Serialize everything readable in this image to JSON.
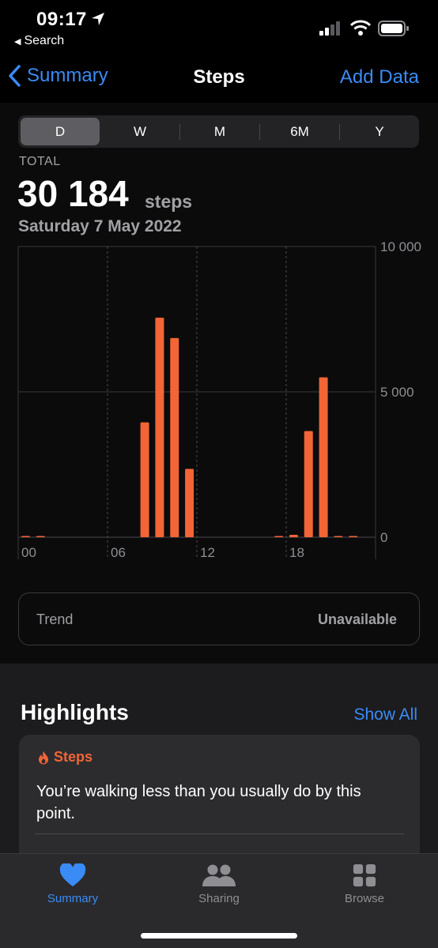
{
  "status_bar": {
    "time": "09:17",
    "back_app": "Search",
    "icons": [
      "location-arrow-icon",
      "signal-icon",
      "wifi-icon",
      "battery-icon"
    ]
  },
  "nav": {
    "back_label": "Summary",
    "title": "Steps",
    "action_label": "Add Data"
  },
  "range_tabs": [
    "D",
    "W",
    "M",
    "6M",
    "Y"
  ],
  "selected_range": "D",
  "summary": {
    "total_label": "TOTAL",
    "total_value": "30 184",
    "unit": "steps",
    "date": "Saturday 7 May 2022"
  },
  "chart_data": {
    "type": "bar",
    "x_tick_labels": [
      "00",
      "06",
      "12",
      "18"
    ],
    "y_tick_labels": [
      "10 000",
      "5 000",
      "0"
    ],
    "ylim": [
      0,
      10000
    ],
    "hours": [
      0,
      1,
      2,
      3,
      4,
      5,
      6,
      7,
      8,
      9,
      10,
      11,
      12,
      13,
      14,
      15,
      16,
      17,
      18,
      19,
      20,
      21,
      22,
      23
    ],
    "values": [
      20,
      15,
      0,
      0,
      0,
      0,
      0,
      0,
      3950,
      7550,
      6850,
      2350,
      0,
      0,
      0,
      0,
      0,
      30,
      80,
      3650,
      5500,
      40,
      30,
      0
    ],
    "bar_color": "#f26536",
    "grid": true
  },
  "trend": {
    "label": "Trend",
    "value": "Unavailable"
  },
  "highlights": {
    "title": "Highlights",
    "show_all": "Show All",
    "card": {
      "category": "Steps",
      "icon": "flame-icon",
      "text": "You’re walking less than you usually do by this point."
    }
  },
  "tabbar": {
    "items": [
      {
        "label": "Summary",
        "icon": "heart-icon",
        "active": true
      },
      {
        "label": "Sharing",
        "icon": "people-icon",
        "active": false
      },
      {
        "label": "Browse",
        "icon": "grid-icon",
        "active": false
      }
    ]
  },
  "colors": {
    "accent": "#3a8bf6",
    "steps": "#f26536",
    "background": "#000000",
    "card": "#2c2c2e"
  }
}
